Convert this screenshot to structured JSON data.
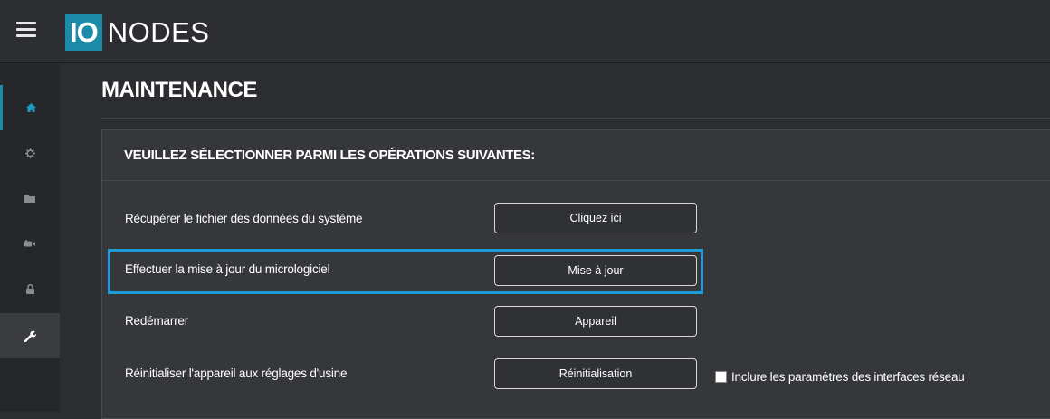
{
  "header": {
    "logo_io": "IO",
    "logo_nodes": "NODES",
    "menu_icon": "hamburger-menu-icon"
  },
  "sidebar": {
    "items": [
      {
        "icon": "home-icon",
        "active": false
      },
      {
        "icon": "gear-icon",
        "active": false
      },
      {
        "icon": "folder-icon",
        "active": false
      },
      {
        "icon": "video-camera-icon",
        "active": false
      },
      {
        "icon": "lock-icon",
        "active": false
      },
      {
        "icon": "wrench-icon",
        "active": true
      }
    ]
  },
  "page": {
    "title": "MAINTENANCE"
  },
  "panel": {
    "heading": "VEUILLEZ SÉLECTIONNER PARMI LES OPÉRATIONS SUIVANTES:",
    "rows": [
      {
        "label": "Récupérer le fichier des données du système",
        "button": "Cliquez ici"
      },
      {
        "label": "Effectuer la mise à jour du micrologiciel",
        "button": "Mise à jour"
      },
      {
        "label": "Redémarrer",
        "button": "Appareil"
      },
      {
        "label": "Réinitialiser l'appareil aux réglages d'usine",
        "button": "Réinitialisation"
      }
    ],
    "checkbox_label": "Inclure les paramètres des interfaces réseau",
    "checkbox_checked": false
  },
  "colors": {
    "accent": "#1a8ba8",
    "highlight": "#1e9cd7",
    "background": "#2b2d30",
    "panel": "#35373b"
  }
}
